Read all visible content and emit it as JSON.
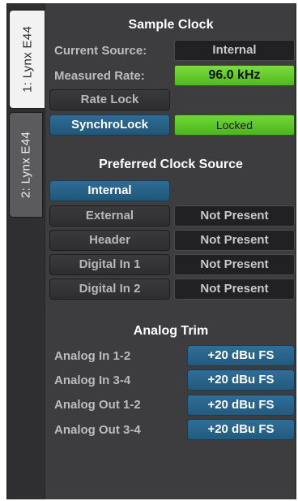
{
  "tabs": [
    {
      "label": "1: Lynx E44",
      "active": true
    },
    {
      "label": "2: Lynx E44",
      "active": false
    }
  ],
  "sample_clock": {
    "title": "Sample Clock",
    "current_source_label": "Current Source:",
    "current_source_value": "Internal",
    "measured_rate_label": "Measured Rate:",
    "measured_rate_value": "96.0 kHz",
    "rate_lock_label": "Rate Lock",
    "synchrolock_label": "SynchroLock",
    "synchrolock_status": "Locked"
  },
  "preferred_clock": {
    "title": "Preferred Clock Source",
    "sources": [
      {
        "label": "Internal",
        "status": "",
        "selected": true
      },
      {
        "label": "External",
        "status": "Not Present",
        "selected": false
      },
      {
        "label": "Header",
        "status": "Not Present",
        "selected": false
      },
      {
        "label": "Digital In 1",
        "status": "Not Present",
        "selected": false
      },
      {
        "label": "Digital In 2",
        "status": "Not Present",
        "selected": false
      }
    ]
  },
  "analog_trim": {
    "title": "Analog Trim",
    "rows": [
      {
        "label": "Analog In 1-2",
        "value": "+20 dBu FS"
      },
      {
        "label": "Analog In 3-4",
        "value": "+20 dBu FS"
      },
      {
        "label": "Analog Out 1-2",
        "value": "+20 dBu FS"
      },
      {
        "label": "Analog Out 3-4",
        "value": "+20 dBu FS"
      }
    ]
  },
  "colors": {
    "panel_bg": "#3d3d3f",
    "accent_blue": "#2d6c97",
    "status_green": "#5ec82b"
  }
}
